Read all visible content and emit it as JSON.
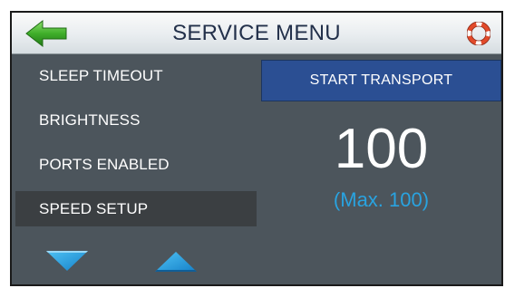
{
  "header": {
    "title": "SERVICE MENU",
    "back_icon": "back-arrow-icon",
    "help_icon": "lifebuoy-icon"
  },
  "menu": {
    "items": [
      {
        "label": "SLEEP TIMEOUT"
      },
      {
        "label": "BRIGHTNESS"
      },
      {
        "label": "PORTS ENABLED"
      },
      {
        "label": "SPEED SETUP",
        "selected": true
      }
    ]
  },
  "panel": {
    "start_button_label": "START TRANSPORT",
    "value": "100",
    "max_label": "(Max. 100)"
  },
  "navigation": {
    "down_icon": "down-triangle-icon",
    "up_icon": "up-triangle-icon"
  },
  "colors": {
    "background": "#4c555c",
    "selected_row": "#3b3f42",
    "start_button": "#2b4f93",
    "accent_blue": "#29a3e0",
    "back_arrow_green": "#3fae2a",
    "help_icon_red": "#e24a2a"
  }
}
